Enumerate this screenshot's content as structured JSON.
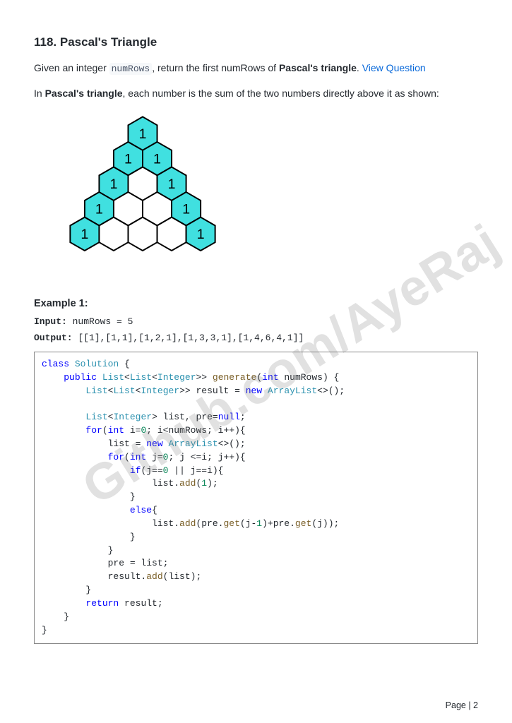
{
  "title": "118. Pascal's Triangle",
  "intro_pre": "Given an integer ",
  "intro_code": "numRows",
  "intro_mid": ", return the first numRows of ",
  "intro_bold": "Pascal's triangle",
  "intro_post": ". ",
  "link_text": "View Question",
  "desc_pre": "In ",
  "desc_bold": "Pascal's triangle",
  "desc_post": ", each number is the sum of the two numbers directly above it as shown:",
  "example_heading": "Example 1:",
  "input_label": "Input:",
  "input_value": " numRows = 5",
  "output_label": "Output:",
  "output_value": " [[1],[1,1],[1,2,1],[1,3,3,1],[1,4,6,4,1]]",
  "code": {
    "l1a": "class",
    "l1b": " Solution",
    "l1c": " {",
    "l2a": "public",
    "l2b": " List",
    "l2c": "<",
    "l2d": "List",
    "l2e": "<",
    "l2f": "Integer",
    "l2g": ">> ",
    "l2h": "generate",
    "l2i": "(",
    "l2j": "int",
    "l2k": " numRows) {",
    "l3a": "List",
    "l3b": "<",
    "l3c": "List",
    "l3d": "<",
    "l3e": "Integer",
    "l3f": ">> result = ",
    "l3g": "new",
    "l3h": " ArrayList",
    "l3i": "<>();",
    "l4": "",
    "l5a": "List",
    "l5b": "<",
    "l5c": "Integer",
    "l5d": "> list, pre=",
    "l5e": "null",
    "l5f": ";",
    "l6a": "for",
    "l6b": "(",
    "l6c": "int",
    "l6d": " i=",
    "l6e": "0",
    "l6f": "; i<numRows; i++){",
    "l7a": "list = ",
    "l7b": "new",
    "l7c": " ArrayList",
    "l7d": "<>();",
    "l8a": "for",
    "l8b": "(",
    "l8c": "int",
    "l8d": " j=",
    "l8e": "0",
    "l8f": "; j <=i; j++){",
    "l9a": "if",
    "l9b": "(j==",
    "l9c": "0",
    "l9d": " || j==i){",
    "l10a": "list.",
    "l10b": "add",
    "l10c": "(",
    "l10d": "1",
    "l10e": ");",
    "l11": "}",
    "l12a": "else",
    "l12b": "{",
    "l13a": "list.",
    "l13b": "add",
    "l13c": "(pre.",
    "l13d": "get",
    "l13e": "(j-",
    "l13f": "1",
    "l13g": ")+pre.",
    "l13h": "get",
    "l13i": "(j));",
    "l14": "}",
    "l15": "}",
    "l16": "pre = list;",
    "l17a": "result.",
    "l17b": "add",
    "l17c": "(list);",
    "l18": "}",
    "l19a": "return",
    "l19b": " result;",
    "l20": "}",
    "l21": "}"
  },
  "watermark": "Github.com/AyeRaj",
  "footer": "Page | 2",
  "hex": {
    "fill": "#40e0e0",
    "stroke": "#000",
    "rows": [
      [
        1
      ],
      [
        1,
        1
      ],
      [
        1,
        null,
        1
      ],
      [
        1,
        null,
        null,
        1
      ],
      [
        1,
        null,
        null,
        null,
        1
      ]
    ]
  }
}
